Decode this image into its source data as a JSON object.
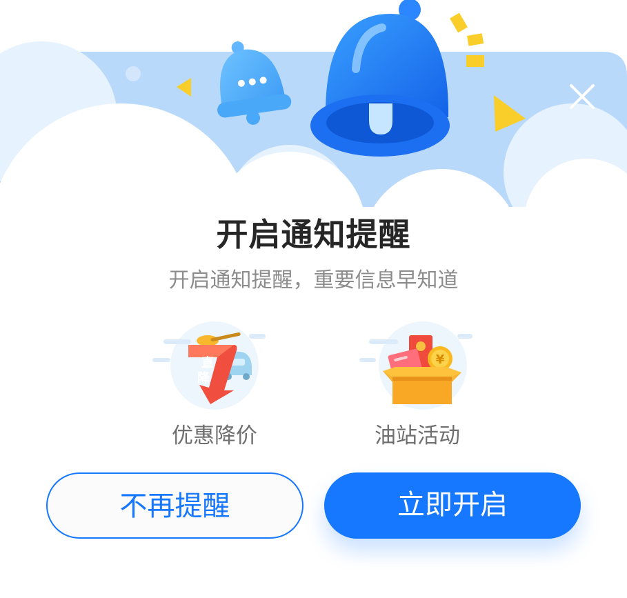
{
  "dialog": {
    "title": "开启通知提醒",
    "subtitle": "开启通知提醒，重要信息早知道",
    "features": [
      {
        "label": "优惠降价",
        "icon": "price-drop-icon",
        "badge_text": [
          "直",
          "降"
        ]
      },
      {
        "label": "油站活动",
        "icon": "gift-box-icon",
        "coin_text": "¥"
      }
    ],
    "buttons": {
      "dismiss_label": "不再提醒",
      "enable_label": "立即开启"
    },
    "icons": {
      "close": "close-icon",
      "large_bell": "bell-icon",
      "small_bell": "small-bell-icon"
    },
    "colors": {
      "primary": "#1677ff",
      "header_sky": "#b8d8fb",
      "title": "#262626",
      "subtitle": "#8c8c8c"
    }
  }
}
